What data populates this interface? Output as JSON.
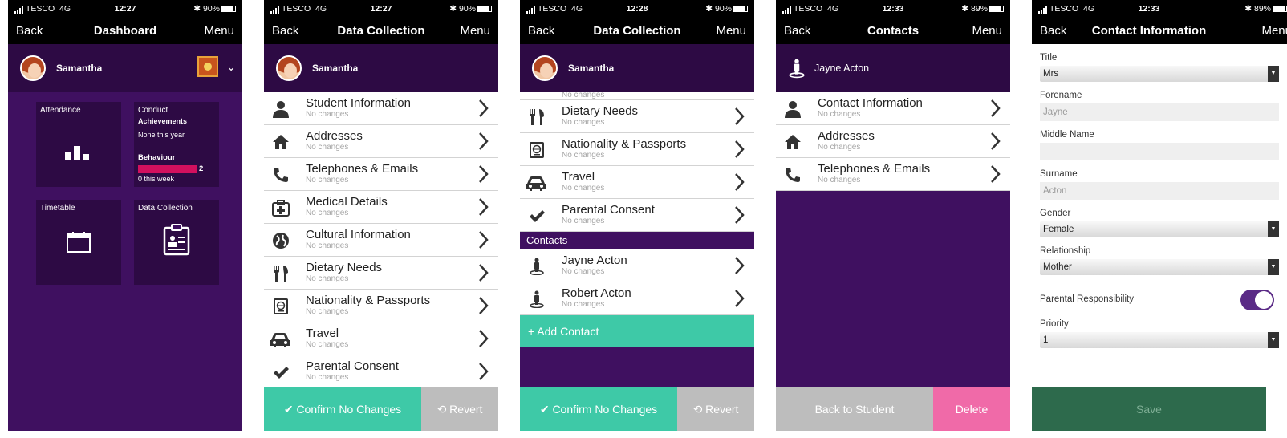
{
  "status": [
    {
      "carrier": "TESCO",
      "network": "4G",
      "time": "12:27",
      "battery": "90%"
    },
    {
      "carrier": "TESCO",
      "network": "4G",
      "time": "12:27",
      "battery": "90%"
    },
    {
      "carrier": "TESCO",
      "network": "4G",
      "time": "12:28",
      "battery": "90%"
    },
    {
      "carrier": "TESCO",
      "network": "4G",
      "time": "12:33",
      "battery": "89%"
    },
    {
      "carrier": "TESCO",
      "network": "4G",
      "time": "12:33",
      "battery": "89%"
    }
  ],
  "nav": {
    "back": "Back",
    "menu": "Menu",
    "menu_truncated": "Menu"
  },
  "screen1": {
    "title": "Dashboard",
    "user": "Samantha",
    "tiles": {
      "attendance": "Attendance",
      "conduct": "Conduct",
      "achievements_heading": "Achievements",
      "achievements_value": "None this year",
      "behaviour_heading": "Behaviour",
      "behaviour_count": "2",
      "behaviour_week": "0 this week",
      "timetable": "Timetable",
      "data_collection": "Data Collection"
    }
  },
  "screen2": {
    "title": "Data Collection",
    "user": "Samantha",
    "rows": [
      {
        "title": "Student Information",
        "sub": "No changes"
      },
      {
        "title": "Addresses",
        "sub": "No changes"
      },
      {
        "title": "Telephones & Emails",
        "sub": "No changes"
      },
      {
        "title": "Medical Details",
        "sub": "No changes"
      },
      {
        "title": "Cultural Information",
        "sub": "No changes"
      },
      {
        "title": "Dietary Needs",
        "sub": "No changes"
      },
      {
        "title": "Nationality & Passports",
        "sub": "No changes"
      },
      {
        "title": "Travel",
        "sub": "No changes"
      },
      {
        "title": "Parental Consent",
        "sub": "No changes"
      }
    ],
    "confirm": "✔ Confirm No Changes",
    "revert": "⟲ Revert"
  },
  "screen3": {
    "title": "Data Collection",
    "user": "Samantha",
    "partial_sub": "No changes",
    "rows": [
      {
        "title": "Dietary Needs",
        "sub": "No changes"
      },
      {
        "title": "Nationality & Passports",
        "sub": "No changes"
      },
      {
        "title": "Travel",
        "sub": "No changes"
      },
      {
        "title": "Parental Consent",
        "sub": "No changes"
      }
    ],
    "contacts_heading": "Contacts",
    "contacts": [
      {
        "title": "Jayne Acton",
        "sub": "No changes"
      },
      {
        "title": "Robert Acton",
        "sub": "No changes"
      }
    ],
    "add_contact": "+   Add Contact",
    "confirm": "✔ Confirm No Changes",
    "revert": "⟲ Revert"
  },
  "screen4": {
    "title": "Contacts",
    "contact_name": "Jayne Acton",
    "rows": [
      {
        "title": "Contact Information",
        "sub": "No changes"
      },
      {
        "title": "Addresses",
        "sub": "No changes"
      },
      {
        "title": "Telephones & Emails",
        "sub": "No changes"
      }
    ],
    "back_to_student": "Back to Student",
    "delete": "Delete"
  },
  "screen5": {
    "title": "Contact Information",
    "fields": {
      "title_label": "Title",
      "title_value": "Mrs",
      "forename_label": "Forename",
      "forename_value": "Jayne",
      "middle_label": "Middle Name",
      "middle_value": "",
      "surname_label": "Surname",
      "surname_value": "Acton",
      "gender_label": "Gender",
      "gender_value": "Female",
      "relationship_label": "Relationship",
      "relationship_value": "Mother",
      "parental_label": "Parental Responsibility",
      "priority_label": "Priority",
      "priority_value": "1"
    },
    "save": "Save"
  },
  "colors": {
    "purple": "#3f1060",
    "dark_purple": "#2d0a44",
    "teal": "#3ec9a7",
    "grey": "#bdbdbd",
    "pink": "#f06aa8",
    "save_green": "#2d6a4c",
    "behaviour_bar": "#d2105e"
  }
}
